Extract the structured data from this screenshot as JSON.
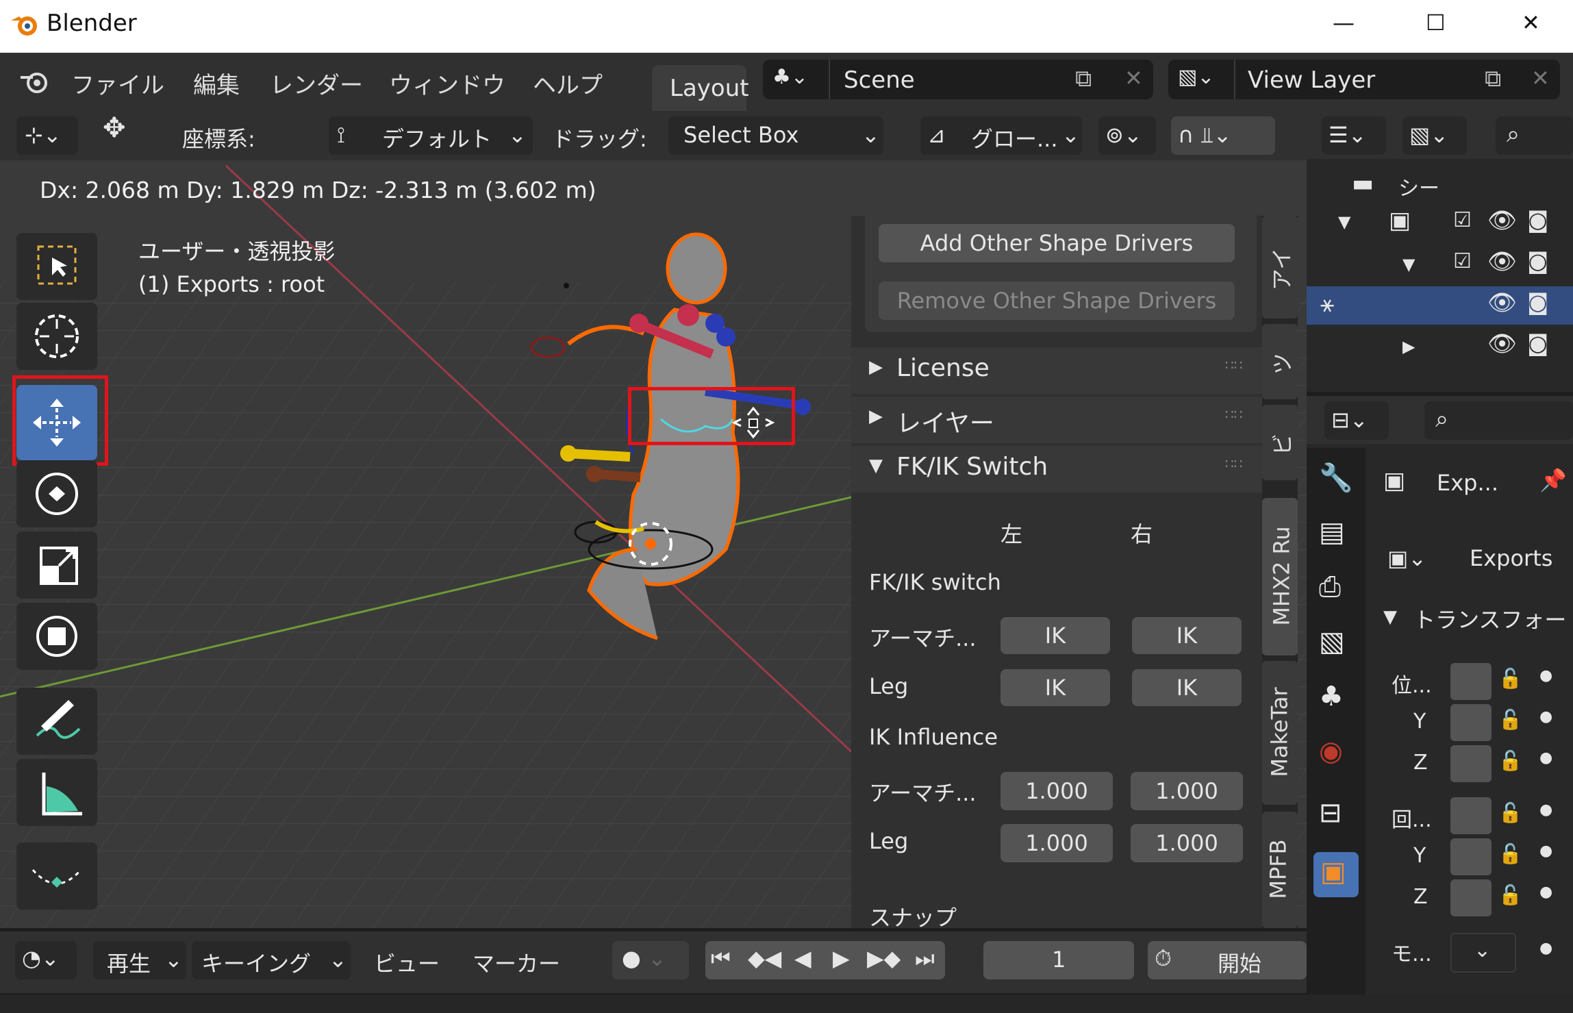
{
  "window": {
    "title": "Blender",
    "controls": [
      "—",
      "☐",
      "✕"
    ]
  },
  "menu": {
    "items": [
      "ファイル",
      "編集",
      "レンダー",
      "ウィンドウ",
      "ヘルプ"
    ],
    "workspace_tab": "Layout",
    "scene": "Scene",
    "view_layer": "View Layer"
  },
  "viewport_header": {
    "orientation_label": "座標系:",
    "orientation_value": "デフォルト",
    "drag_label": "ドラッグ:",
    "drag_value": "Select Box",
    "transform_value": "グロー..."
  },
  "transform_readout": "Dx: 2.068 m  Dy: 1.829 m  Dz: -2.313 m (3.602 m)",
  "viewport_info": {
    "line1": "ユーザー・透視投影",
    "line2": "(1) Exports : root"
  },
  "tools": [
    "select-box",
    "cursor",
    "move",
    "rotate",
    "scale",
    "transform",
    "annotate",
    "measure",
    "add"
  ],
  "active_tool": "move",
  "npanel": {
    "btn_add": "Add Other Shape Drivers",
    "btn_remove": "Remove Other Shape Drivers",
    "section_license": "License",
    "section_layer": "レイヤー",
    "section_fkik": "FK/IK Switch",
    "col_left": "左",
    "col_right": "右",
    "fkik_switch_label": "FK/IK switch",
    "row_arm": "アーマチ...",
    "row_leg": "Leg",
    "ik": "IK",
    "ik_influence_label": "IK Influence",
    "arm_influence_left": "1.000",
    "arm_influence_right": "1.000",
    "leg_influence_left": "1.000",
    "leg_influence_right": "1.000",
    "snap_label": "スナップ"
  },
  "side_tabs": [
    "アイ",
    "ツ",
    "ビ",
    "MHX2 Ru",
    "MakeTar",
    "MPFB"
  ],
  "outliner": {
    "scene_label": "シー"
  },
  "properties": {
    "object_short": "Exp...",
    "object_name": "Exports",
    "section_transform": "トランスフォー",
    "location_label": "位...",
    "rotation_label": "回...",
    "mode_label": "モ...",
    "axis_y": "Y",
    "axis_z": "Z"
  },
  "timeline": {
    "play_label": "再生",
    "keying_label": "キーイング",
    "view_label": "ビュー",
    "marker_label": "マーカー",
    "frame": "1",
    "start_label": "開始"
  },
  "colors": {
    "accent_blue": "#4772b3",
    "highlight_red": "#e1141b",
    "panel": "#303030",
    "viewport": "#3a3a3a"
  }
}
